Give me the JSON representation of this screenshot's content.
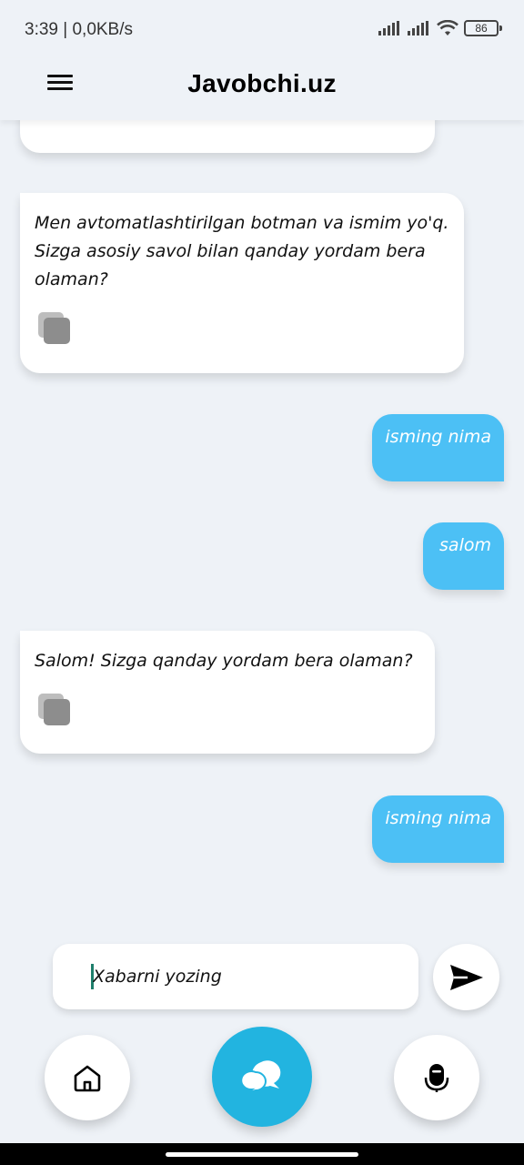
{
  "status_bar": {
    "time": "3:39 | 0,0KB/s",
    "battery": "86",
    "icons": [
      "signal-icon",
      "signal-icon",
      "wifi-icon",
      "battery-icon"
    ]
  },
  "header": {
    "title": "Javobchi.uz",
    "menu_icon": "hamburger-menu-icon"
  },
  "messages": [
    {
      "sender": "bot",
      "text": ""
    },
    {
      "sender": "bot",
      "text": "Men avtomatlashtirilgan botman va ismim yo'q. Sizga asosiy savol bilan qanday yordam bera olaman?"
    },
    {
      "sender": "user",
      "text": "isming nima"
    },
    {
      "sender": "user",
      "text": "salom"
    },
    {
      "sender": "bot",
      "text": "Salom! Sizga qanday yordam bera olaman?"
    },
    {
      "sender": "user",
      "text": "isming nima"
    }
  ],
  "composer": {
    "placeholder": "Xabarni yozing",
    "value": ""
  },
  "bottom_nav": {
    "items": [
      "home-icon",
      "chat-icon",
      "microphone-icon"
    ]
  },
  "colors": {
    "background": "#eef2f7",
    "user_bubble": "#4cc0f5",
    "accent": "#22b4e0",
    "bot_bubble": "#ffffff"
  }
}
